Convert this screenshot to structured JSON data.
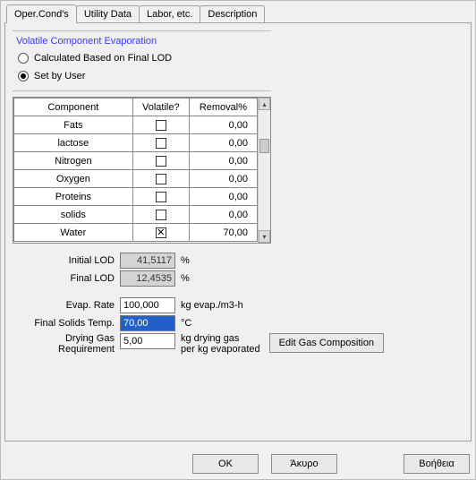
{
  "tabs": {
    "oper": "Oper.Cond's",
    "util": "Utility Data",
    "labor": "Labor, etc.",
    "desc": "Description"
  },
  "group": {
    "title": "Volatile Component Evaporation",
    "radio_calc": "Calculated Based on Final LOD",
    "radio_user": "Set by User"
  },
  "table": {
    "head_component": "Component",
    "head_volatile": "Volatile?",
    "head_removal": "Removal%",
    "rows": [
      {
        "name": "Fats",
        "volatile": false,
        "removal": "0,00"
      },
      {
        "name": "lactose",
        "volatile": false,
        "removal": "0,00"
      },
      {
        "name": "Nitrogen",
        "volatile": false,
        "removal": "0,00"
      },
      {
        "name": "Oxygen",
        "volatile": false,
        "removal": "0,00"
      },
      {
        "name": "Proteins",
        "volatile": false,
        "removal": "0,00"
      },
      {
        "name": "solids",
        "volatile": false,
        "removal": "0,00"
      },
      {
        "name": "Water",
        "volatile": true,
        "removal": "70,00"
      }
    ]
  },
  "lod": {
    "initial_label": "Initial LOD",
    "initial_value": "41,5117",
    "final_label": "Final LOD",
    "final_value": "12,4535",
    "unit": "%"
  },
  "fields": {
    "evap_rate_label": "Evap. Rate",
    "evap_rate_value": "100,000",
    "evap_rate_unit": "kg evap./m3-h",
    "final_solids_label": "Final Solids Temp.",
    "final_solids_value": "70,00",
    "final_solids_unit": "°C",
    "drying_gas_label1": "Drying Gas",
    "drying_gas_label2": "Requirement",
    "drying_gas_value": "5,00",
    "drying_gas_unit1": "kg drying gas",
    "drying_gas_unit2": "per kg evaporated",
    "edit_gas_btn": "Edit Gas Composition"
  },
  "buttons": {
    "ok": "OK",
    "cancel": "Άκυρο",
    "help": "Βοήθεια"
  }
}
